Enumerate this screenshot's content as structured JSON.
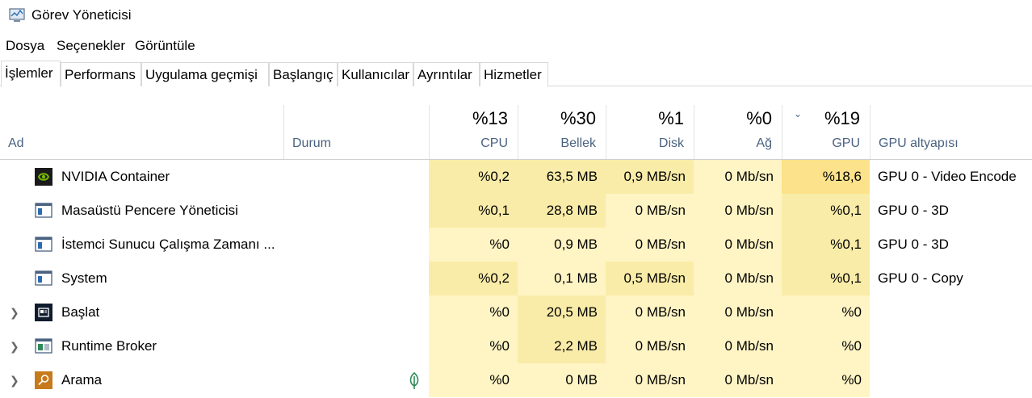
{
  "window": {
    "title": "Görev Yöneticisi"
  },
  "menu": {
    "items": [
      "Dosya",
      "Seçenekler",
      "Görüntüle"
    ]
  },
  "tabs": [
    "İşlemler",
    "Performans",
    "Uygulama geçmişi",
    "Başlangıç",
    "Kullanıcılar",
    "Ayrıntılar",
    "Hizmetler"
  ],
  "active_tab": "İşlemler",
  "columns": {
    "name": "Ad",
    "status": "Durum",
    "cpu": {
      "pct": "%13",
      "label": "CPU"
    },
    "memory": {
      "pct": "%30",
      "label": "Bellek"
    },
    "disk": {
      "pct": "%1",
      "label": "Disk"
    },
    "network": {
      "pct": "%0",
      "label": "Ağ"
    },
    "gpu": {
      "pct": "%19",
      "label": "GPU"
    },
    "gpu_engine": "GPU altyapısı"
  },
  "processes": [
    {
      "name": "NVIDIA Container",
      "icon": "nvidia-icon",
      "expandable": false,
      "status": "",
      "cpu": "%0,2",
      "memory": "63,5 MB",
      "disk": "0,9 MB/sn",
      "network": "0 Mb/sn",
      "gpu": "%18,6",
      "gpu_engine": "GPU 0 - Video Encode"
    },
    {
      "name": "Masaüstü Pencere Yöneticisi",
      "icon": "window-icon",
      "expandable": false,
      "status": "",
      "cpu": "%0,1",
      "memory": "28,8 MB",
      "disk": "0 MB/sn",
      "network": "0 Mb/sn",
      "gpu": "%0,1",
      "gpu_engine": "GPU 0 - 3D"
    },
    {
      "name": "İstemci Sunucu Çalışma Zamanı ...",
      "icon": "window-icon",
      "expandable": false,
      "status": "",
      "cpu": "%0",
      "memory": "0,9 MB",
      "disk": "0 MB/sn",
      "network": "0 Mb/sn",
      "gpu": "%0,1",
      "gpu_engine": "GPU 0 - 3D"
    },
    {
      "name": "System",
      "icon": "window-icon",
      "expandable": false,
      "status": "",
      "cpu": "%0,2",
      "memory": "0,1 MB",
      "disk": "0,5 MB/sn",
      "network": "0 Mb/sn",
      "gpu": "%0,1",
      "gpu_engine": "GPU 0 - Copy"
    },
    {
      "name": "Başlat",
      "icon": "start-icon",
      "expandable": true,
      "status": "",
      "cpu": "%0",
      "memory": "20,5 MB",
      "disk": "0 MB/sn",
      "network": "0 Mb/sn",
      "gpu": "%0",
      "gpu_engine": ""
    },
    {
      "name": "Runtime Broker",
      "icon": "broker-icon",
      "expandable": true,
      "status": "",
      "cpu": "%0",
      "memory": "2,2 MB",
      "disk": "0 MB/sn",
      "network": "0 Mb/sn",
      "gpu": "%0",
      "gpu_engine": ""
    },
    {
      "name": "Arama",
      "icon": "search-icon",
      "expandable": true,
      "status": "suspended-leaf-icon",
      "cpu": "%0",
      "memory": "0 MB",
      "disk": "0 MB/sn",
      "network": "0 Mb/sn",
      "gpu": "%0",
      "gpu_engine": ""
    }
  ]
}
